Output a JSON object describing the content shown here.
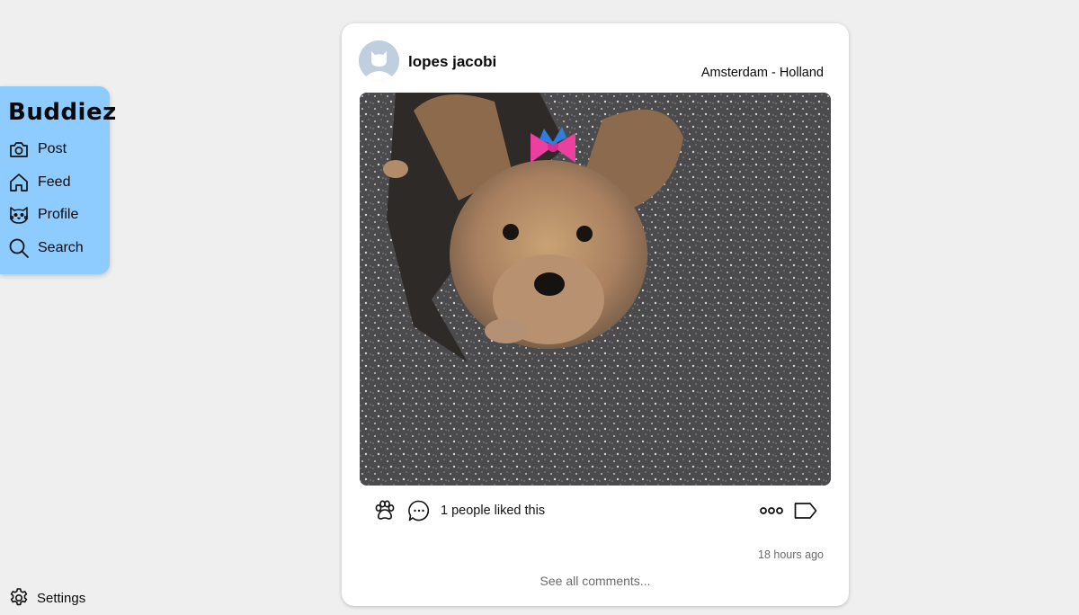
{
  "sidebar": {
    "brand": "Buddiez",
    "items": [
      {
        "label": "Post",
        "icon": "camera-icon"
      },
      {
        "label": "Feed",
        "icon": "home-icon"
      },
      {
        "label": "Profile",
        "icon": "cat-face-icon"
      },
      {
        "label": "Search",
        "icon": "search-icon"
      }
    ],
    "settings_label": "Settings",
    "colors": {
      "background": "#8ecbff"
    }
  },
  "post": {
    "username": "lopes jacobi",
    "location": "Amsterdam - Holland",
    "image_alt": "Yorkshire terrier with a pink bow on asphalt",
    "likes_text": "1 people liked this",
    "timestamp": "18 hours ago",
    "see_comments": "See all comments...",
    "icons": [
      "paw-icon",
      "comment-icon",
      "more-icon",
      "tag-icon"
    ]
  }
}
